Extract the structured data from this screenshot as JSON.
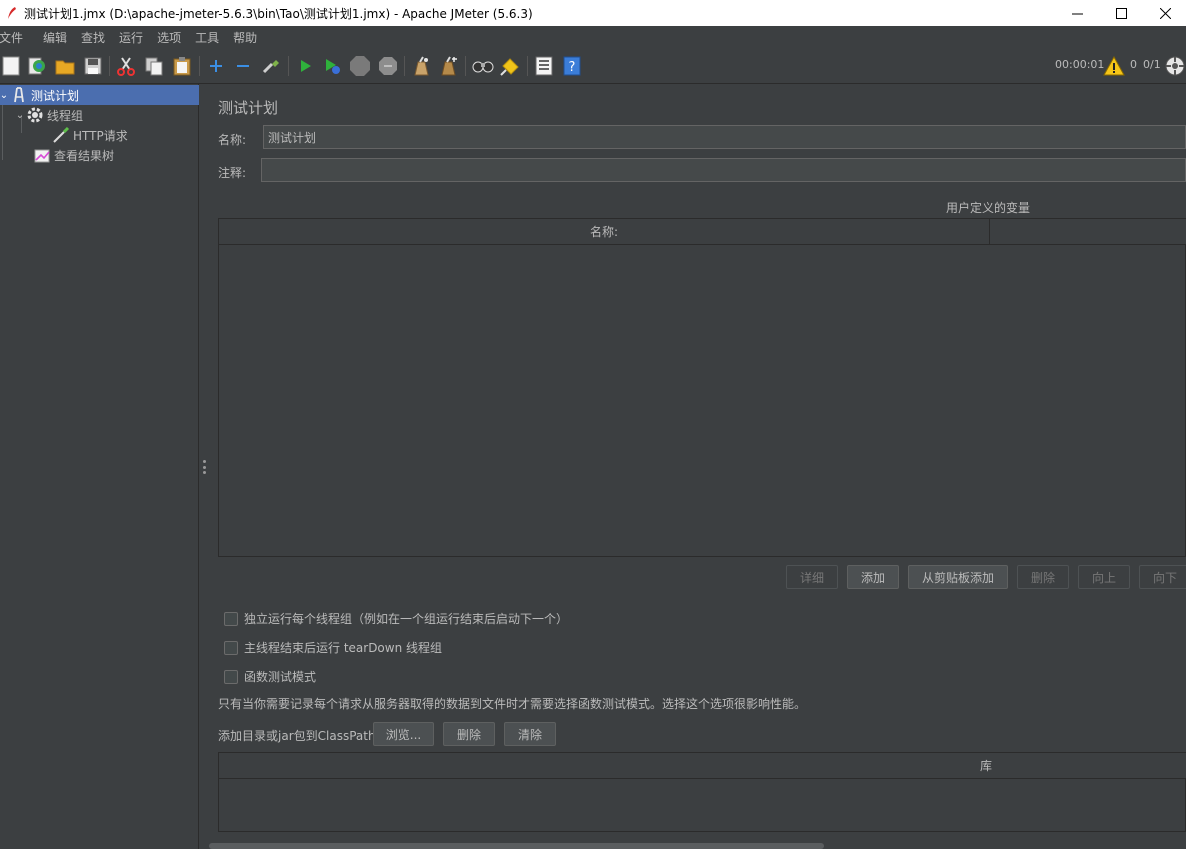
{
  "window": {
    "title": "测试计划1.jmx (D:\\apache-jmeter-5.6.3\\bin\\Tao\\测试计划1.jmx) - Apache JMeter (5.6.3)",
    "minimize_icon": "minimize-icon",
    "maximize_icon": "maximize-icon",
    "close_icon": "close-icon"
  },
  "menu": [
    "文件",
    "编辑",
    "查找",
    "运行",
    "选项",
    "工具",
    "帮助"
  ],
  "toolbar": {
    "buttons": [
      "new-icon",
      "templates-icon",
      "open-icon",
      "save-icon",
      "cut-icon",
      "copy-icon",
      "paste-icon",
      "expand-icon",
      "collapse-icon",
      "toggle-icon",
      "start-icon",
      "start-no-pause-icon",
      "stop-icon",
      "shutdown-icon",
      "clear-icon",
      "clear-all-icon",
      "search-icon",
      "reset-search-icon",
      "function-helper-icon",
      "help-icon"
    ],
    "timer": "00:00:01",
    "warning_count": "0",
    "threads": "0/1"
  },
  "tree": {
    "items": [
      {
        "label": "测试计划",
        "icon": "test-plan-icon",
        "level": 0,
        "selected": true
      },
      {
        "label": "线程组",
        "icon": "gear-icon",
        "level": 1,
        "selected": false
      },
      {
        "label": "HTTP请求",
        "icon": "sampler-icon",
        "level": 2,
        "selected": false
      },
      {
        "label": "查看结果树",
        "icon": "listener-icon",
        "level": 1,
        "selected": false
      }
    ]
  },
  "main": {
    "title": "测试计划",
    "name_label": "名称:",
    "name_value": "测试计划",
    "comment_label": "注释:",
    "comment_value": "",
    "variables_caption": "用户定义的变量",
    "variables_columns": [
      "名称:",
      ""
    ],
    "variables_buttons": {
      "detail": "详细",
      "add": "添加",
      "add_from_clipboard": "从剪贴板添加",
      "delete": "删除",
      "up": "向上",
      "down": "向下"
    },
    "options": [
      {
        "label": "独立运行每个线程组（例如在一个组运行结束后启动下一个）",
        "checked": false
      },
      {
        "label": "主线程结束后运行 tearDown 线程组",
        "checked": false
      },
      {
        "label": "函数测试模式",
        "checked": false
      }
    ],
    "functional_note": "只有当你需要记录每个请求从服务器取得的数据到文件时才需要选择函数测试模式。选择这个选项很影响性能。",
    "classpath_label": "添加目录或jar包到ClassPath",
    "classpath_buttons": {
      "browse": "浏览...",
      "delete": "删除",
      "clear": "清除"
    },
    "library_column": "库"
  },
  "colors": {
    "background": "#3c3f41",
    "selection": "#4b6eaf",
    "text": "#bbbbbb"
  }
}
